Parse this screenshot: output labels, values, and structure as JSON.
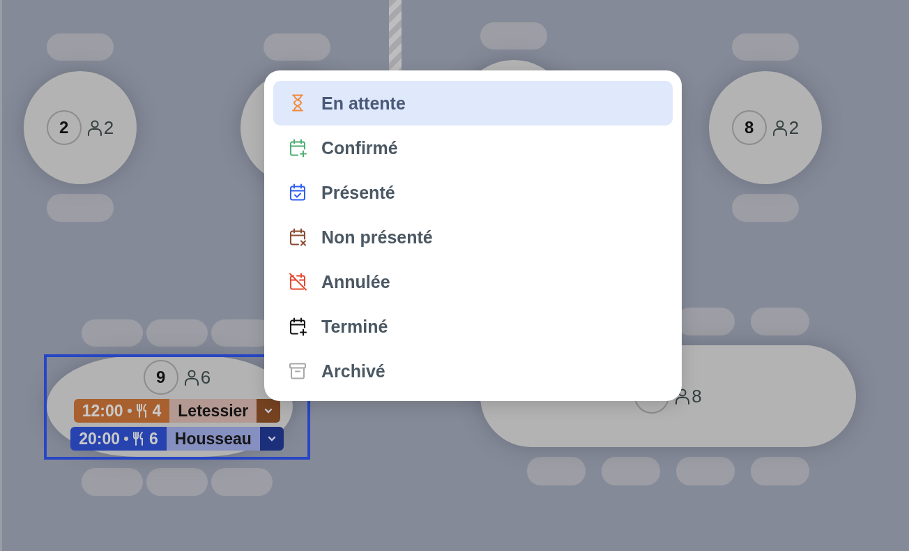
{
  "floor_plan": {
    "tables": [
      {
        "kind": "round",
        "number": "2",
        "guests": "2",
        "selected": false
      },
      {
        "kind": "round",
        "selected": false
      },
      {
        "kind": "round",
        "selected": false
      },
      {
        "kind": "round",
        "number": "8",
        "guests": "2",
        "selected": false
      },
      {
        "kind": "oval",
        "number": "9",
        "guests": "6",
        "selected": true,
        "reservations": [
          {
            "time": "12:00",
            "covers": "4",
            "name": "Letessier",
            "color": "#a9602f"
          },
          {
            "time": "20:00",
            "covers": "6",
            "name": "Housseau",
            "color": "#2643b0"
          }
        ]
      },
      {
        "kind": "oval",
        "guests": "8",
        "selected": false
      }
    ]
  },
  "status_menu": {
    "items": [
      {
        "label": "En attente",
        "kind": "hourglass",
        "color": "#f08a3c",
        "selected": true
      },
      {
        "label": "Confirmé",
        "kind": "calendar-plus",
        "color": "#4caf72",
        "selected": false
      },
      {
        "label": "Présenté",
        "kind": "calendar-check",
        "color": "#2f5ff0",
        "selected": false
      },
      {
        "label": "Non présenté",
        "kind": "calendar-x",
        "color": "#8a4a32",
        "selected": false
      },
      {
        "label": "Annulée",
        "kind": "calendar-off",
        "color": "#e5472f",
        "selected": false
      },
      {
        "label": "Terminé",
        "kind": "calendar-plus",
        "color": "#111111",
        "selected": false
      },
      {
        "label": "Archivé",
        "kind": "archive",
        "color": "#a8a8a8",
        "selected": false
      }
    ]
  }
}
